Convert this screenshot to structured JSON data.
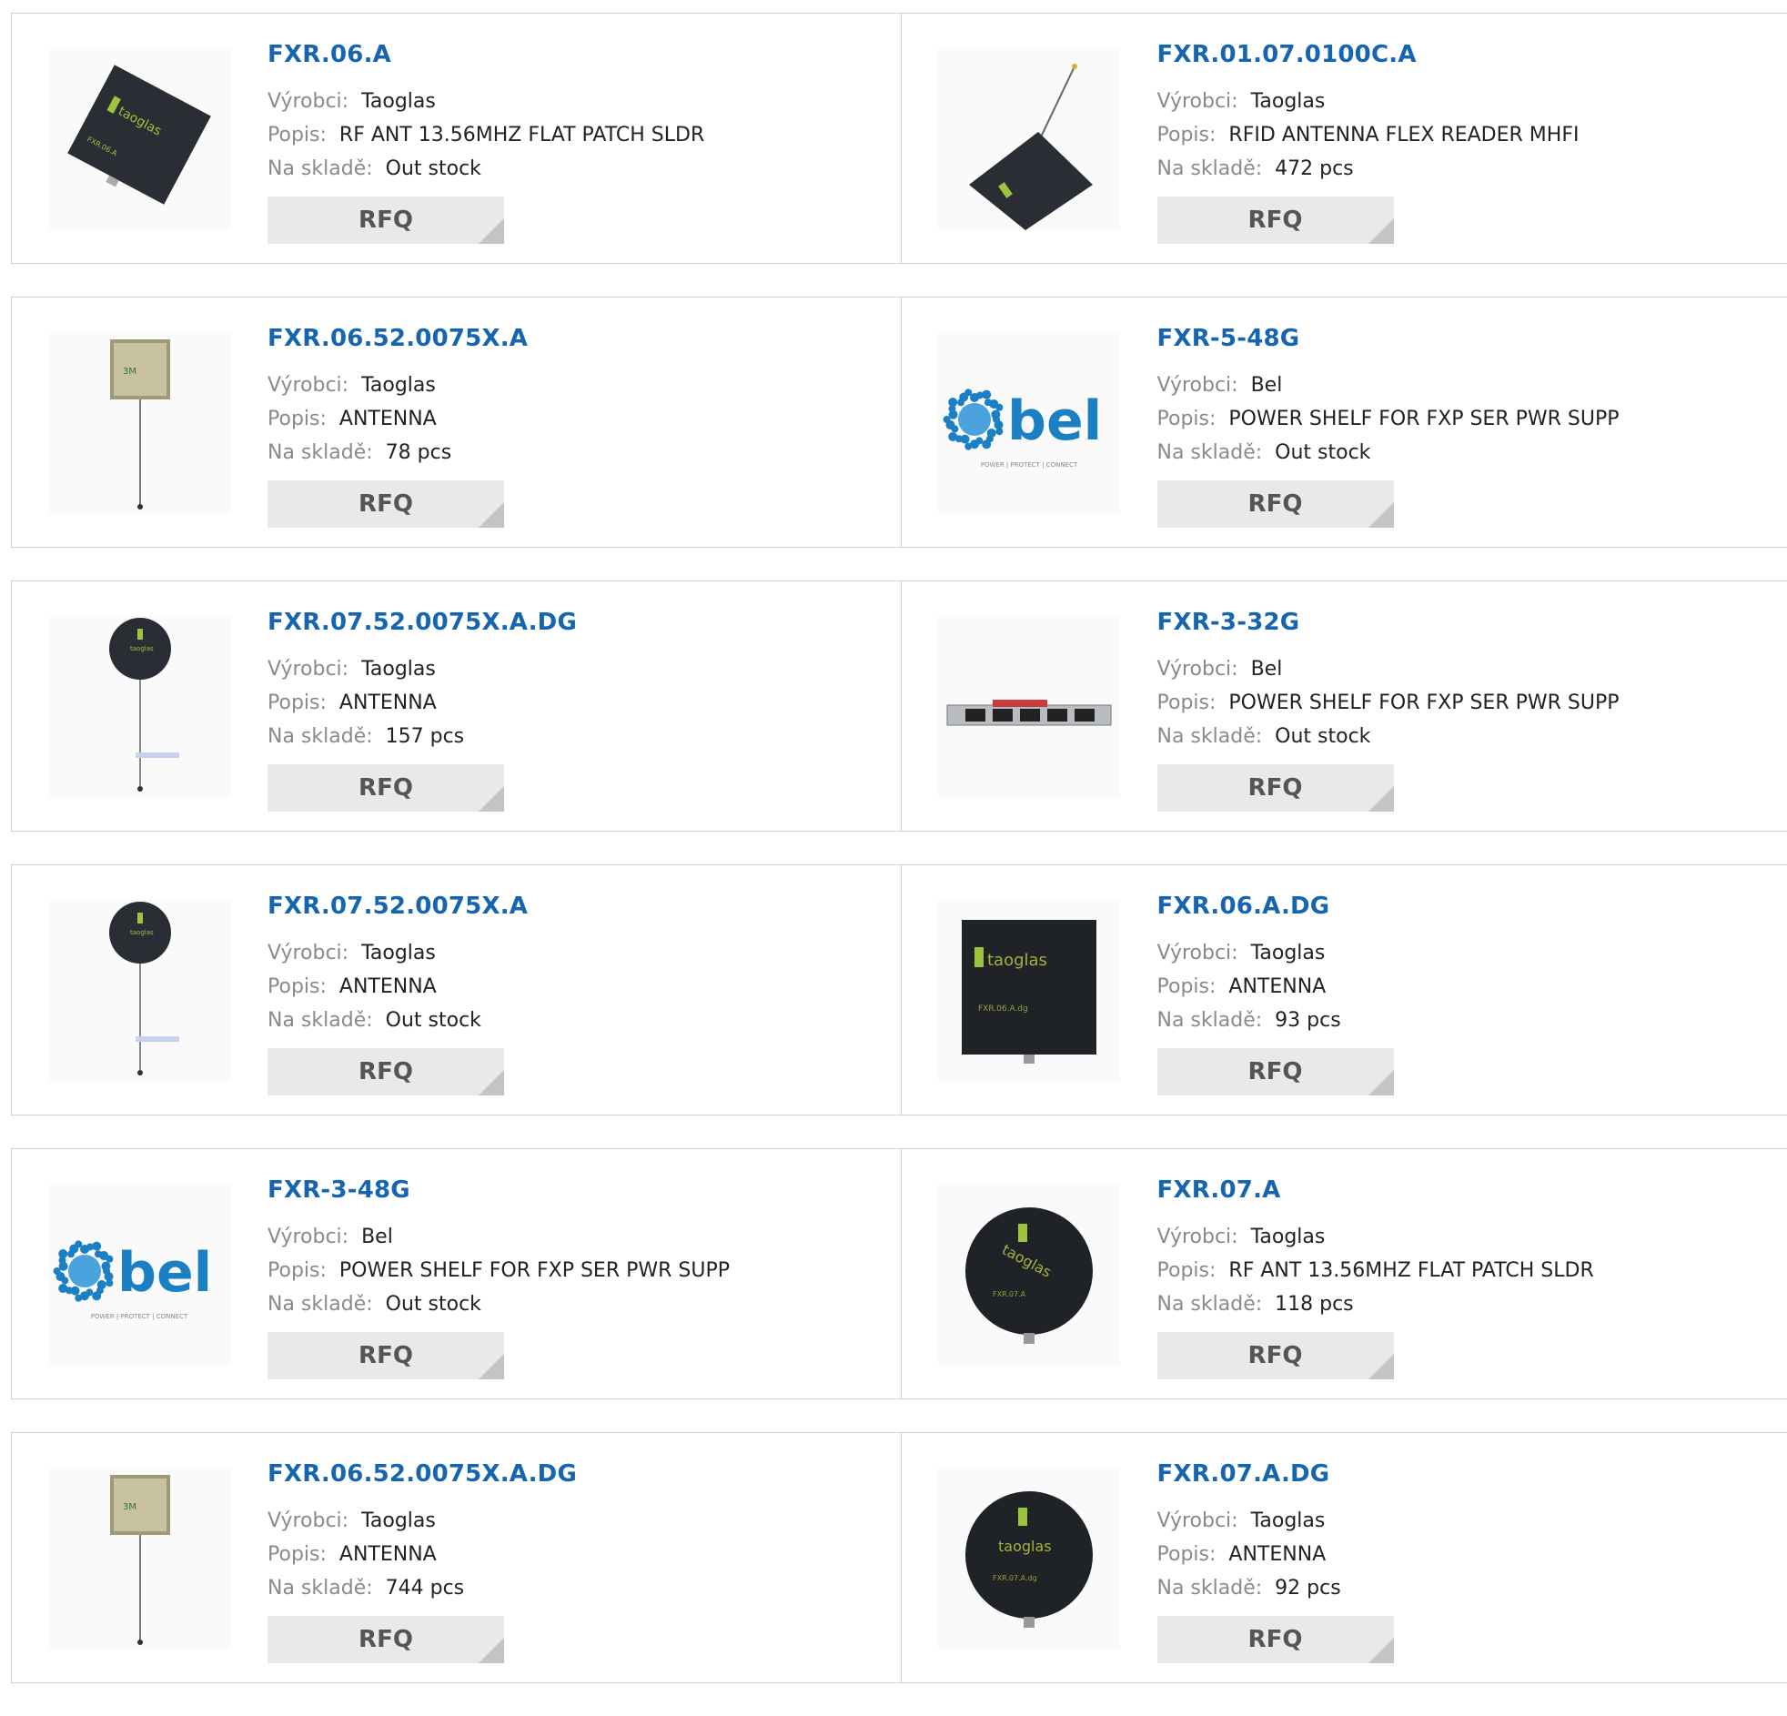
{
  "labels": {
    "manufacturer": "Výrobci:",
    "description": "Popis:",
    "stock": "Na skladě:",
    "rfq": "RFQ"
  },
  "colors": {
    "link": "#1565b0",
    "label": "#8a8a8a",
    "button_bg": "#e9e9e9",
    "bel_blue": "#1b7fc4"
  },
  "products": [
    {
      "part": "FXR.06.A",
      "manufacturer": "Taoglas",
      "description": "RF ANT 13.56MHZ FLAT PATCH SLDR",
      "stock": "Out stock",
      "image": "square-patch-antenna"
    },
    {
      "part": "FXR.01.07.0100C.A",
      "manufacturer": "Taoglas",
      "description": "RFID ANTENNA FLEX READER MHFI",
      "stock": "472 pcs",
      "image": "flex-antenna-with-cable"
    },
    {
      "part": "FXR.06.52.0075X.A",
      "manufacturer": "Taoglas",
      "description": "ANTENNA",
      "stock": "78 pcs",
      "image": "square-patch-with-cable"
    },
    {
      "part": "FXR-5-48G",
      "manufacturer": "Bel",
      "description": "POWER SHELF FOR FXP SER PWR SUPP",
      "stock": "Out stock",
      "image": "bel-logo",
      "logo_text": "bel",
      "logo_tagline": "POWER | PROTECT | CONNECT"
    },
    {
      "part": "FXR.07.52.0075X.A.DG",
      "manufacturer": "Taoglas",
      "description": "ANTENNA",
      "stock": "157 pcs",
      "image": "round-patch-with-cable"
    },
    {
      "part": "FXR-3-32G",
      "manufacturer": "Bel",
      "description": "POWER SHELF FOR FXP SER PWR SUPP",
      "stock": "Out stock",
      "image": "rack-power-shelf"
    },
    {
      "part": "FXR.07.52.0075X.A",
      "manufacturer": "Taoglas",
      "description": "ANTENNA",
      "stock": "Out stock",
      "image": "round-patch-with-cable"
    },
    {
      "part": "FXR.06.A.DG",
      "manufacturer": "Taoglas",
      "description": "ANTENNA",
      "stock": "93 pcs",
      "image": "square-patch-antenna-dg",
      "logo_text": "taoglas",
      "label_text": "FXR.06.A.dg"
    },
    {
      "part": "FXR-3-48G",
      "manufacturer": "Bel",
      "description": "POWER SHELF FOR FXP SER PWR SUPP",
      "stock": "Out stock",
      "image": "bel-logo",
      "logo_text": "bel",
      "logo_tagline": "POWER | PROTECT | CONNECT"
    },
    {
      "part": "FXR.07.A",
      "manufacturer": "Taoglas",
      "description": "RF ANT 13.56MHZ FLAT PATCH SLDR",
      "stock": "118 pcs",
      "image": "round-patch-antenna",
      "logo_text": "taoglas",
      "label_text": "FXR.07.A"
    },
    {
      "part": "FXR.06.52.0075X.A.DG",
      "manufacturer": "Taoglas",
      "description": "ANTENNA",
      "stock": "744 pcs",
      "image": "square-patch-with-cable"
    },
    {
      "part": "FXR.07.A.DG",
      "manufacturer": "Taoglas",
      "description": "ANTENNA",
      "stock": "92 pcs",
      "image": "round-patch-antenna-dg",
      "logo_text": "taoglas",
      "label_text": "FXR.07.A.dg"
    }
  ]
}
